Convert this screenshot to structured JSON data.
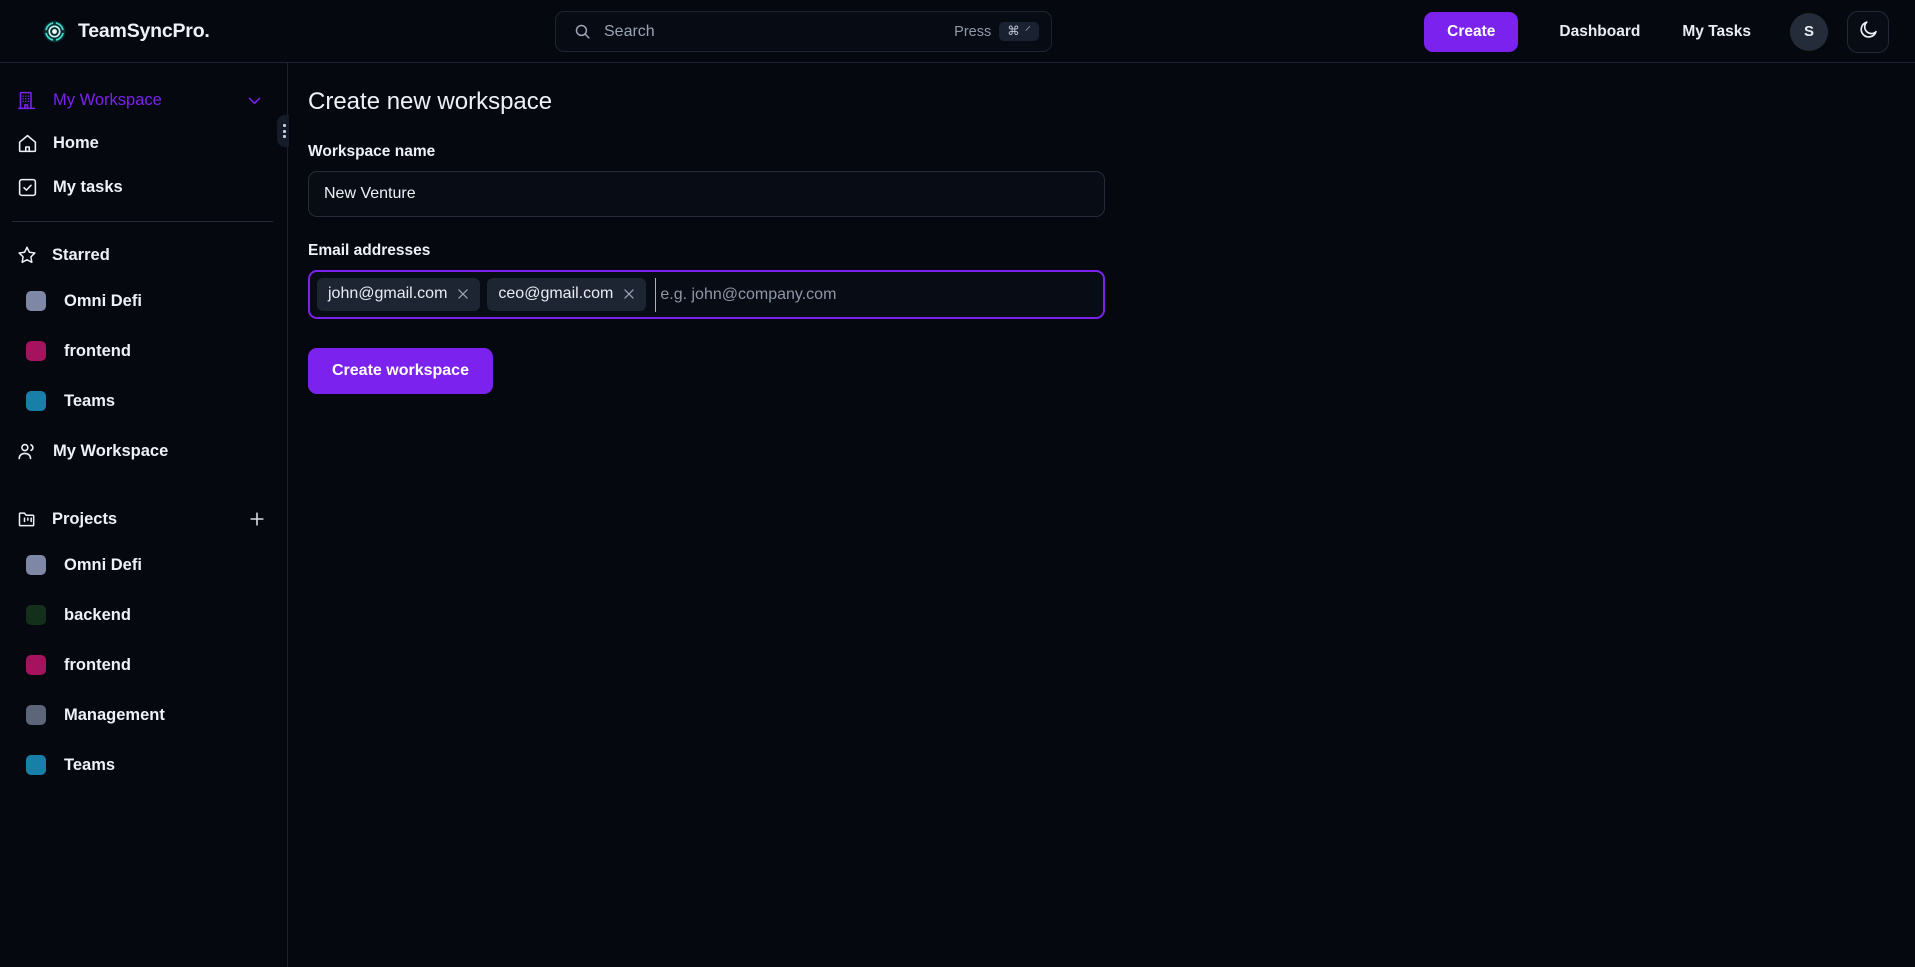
{
  "header": {
    "brand_name": "TeamSyncPro.",
    "logo_icon": "teamsync-pinwheel-logo",
    "search": {
      "icon": "search-icon",
      "placeholder": "Search",
      "press_label": "Press",
      "kbd_cmd": "⌘",
      "kbd_key": "⸍"
    },
    "create_label": "Create",
    "nav": [
      {
        "label": "Dashboard"
      },
      {
        "label": "My Tasks"
      }
    ],
    "avatar_initial": "S",
    "theme_toggle_icon": "moon-icon"
  },
  "sidebar": {
    "workspace_switcher": {
      "icon": "building-icon",
      "name": "My Workspace",
      "chevron_icon": "chevron-down-icon",
      "color": "#7c22ee"
    },
    "drag_handle_icon": "drag-dots-icon",
    "nav_items": [
      {
        "label": "Home",
        "icon": "home-icon"
      },
      {
        "label": "My tasks",
        "icon": "check-square-icon"
      }
    ],
    "starred": {
      "icon": "star-icon",
      "label": "Starred",
      "items": [
        {
          "label": "Omni Defi",
          "color": "#7e87a6"
        },
        {
          "label": "frontend",
          "color": "#a5135f"
        },
        {
          "label": "Teams",
          "color": "#1880a8"
        }
      ],
      "people_item": {
        "label": "My Workspace",
        "icon": "users-icon"
      }
    },
    "projects": {
      "icon": "folder-kanban-icon",
      "label": "Projects",
      "add_icon": "plus-icon",
      "items": [
        {
          "label": "Omni Defi",
          "color": "#7e87a6"
        },
        {
          "label": "backend",
          "color": "#12301a"
        },
        {
          "label": "frontend",
          "color": "#a5135f"
        },
        {
          "label": "Management",
          "color": "#5d6679"
        },
        {
          "label": "Teams",
          "color": "#1880a8"
        }
      ]
    }
  },
  "main": {
    "page_title": "Create new workspace",
    "workspace_name": {
      "label": "Workspace name",
      "value": "New Venture",
      "placeholder": "Workspace name"
    },
    "email_addresses": {
      "label": "Email addresses",
      "chips": [
        {
          "email": "john@gmail.com",
          "remove_icon": "close-icon"
        },
        {
          "email": "ceo@gmail.com",
          "remove_icon": "close-icon"
        }
      ],
      "input_value": "",
      "placeholder": "e.g. john@company.com"
    },
    "submit_label": "Create workspace"
  },
  "colors": {
    "accent": "#7c22ee",
    "background": "#05080f",
    "border": "#1b2230",
    "text": "#eef1f6"
  }
}
